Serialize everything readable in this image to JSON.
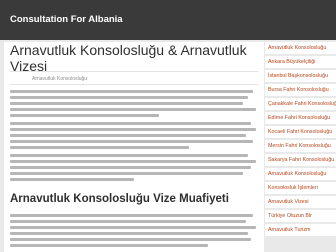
{
  "header": {
    "site_title": "Consultation For Albania"
  },
  "article": {
    "title": "Arnavutluk Konsolosluğu & Arnavutluk Vizesi",
    "meta": "Arnavutluk Konsolosluğu",
    "section_heading": "Arnavutluk Konsolosluğu Vize Muafiyeti"
  },
  "sidebar": {
    "items": [
      {
        "label": "Arnavutluk Konsolosluğu"
      },
      {
        "label": "Ankara Büyükelçiliği"
      },
      {
        "label": "İstanbul Başkonsolosluğu"
      },
      {
        "label": "Bursa Fahri Konsolosluğu"
      },
      {
        "label": "Çanakkale Fahri Konsolosluğu"
      },
      {
        "label": "Edirne Fahri Konsolosluğu"
      },
      {
        "label": "Kocaeli Fahri Konsolosluğu"
      },
      {
        "label": "Mersin Fahri Konsolosluğu"
      },
      {
        "label": "Sakarya Fahri Konsolosluğu"
      },
      {
        "label": "Arnavutluk Konsolosluğu"
      },
      {
        "label": "Konsolosluk İşlemleri"
      },
      {
        "label": "Arnavutluk Vizesi"
      },
      {
        "label": "Türkiye Otuzun Bir"
      },
      {
        "label": "Arnavutluk Turizm"
      }
    ]
  }
}
